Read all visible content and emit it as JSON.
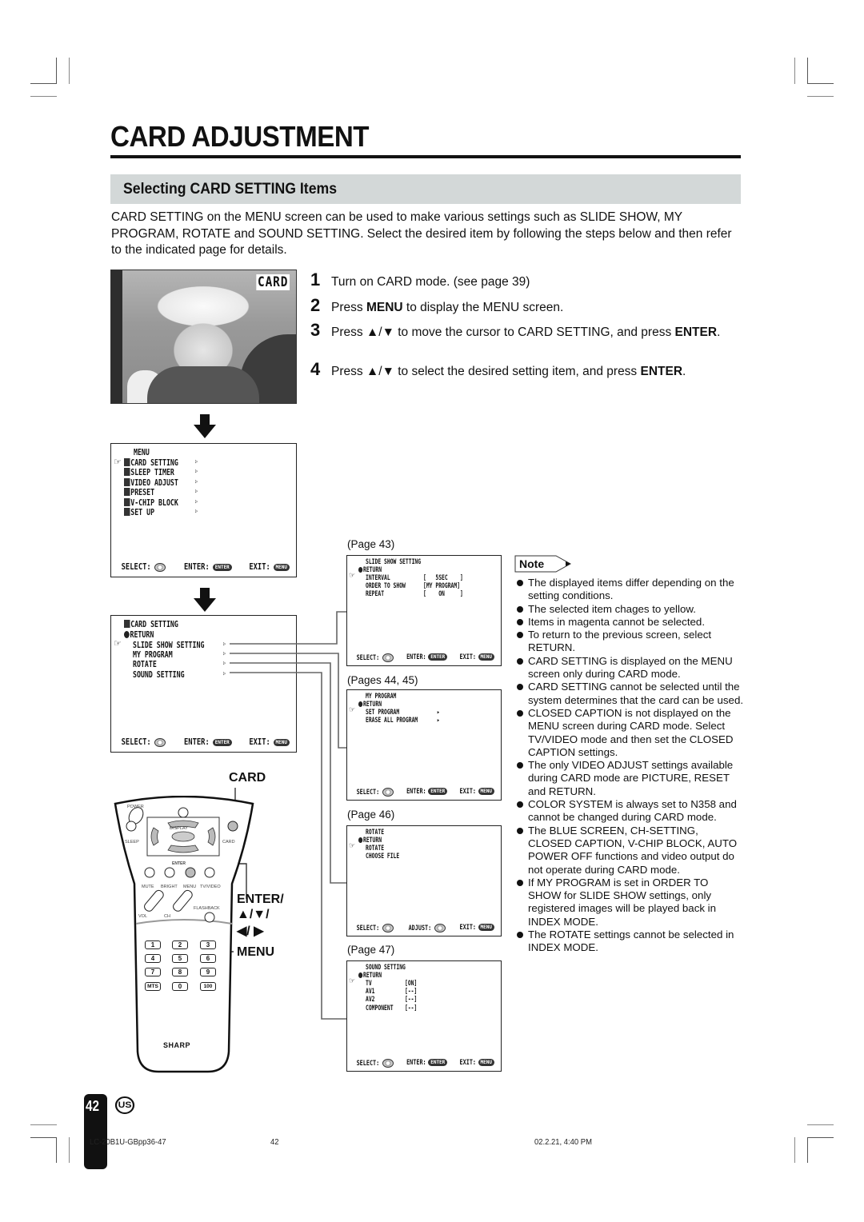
{
  "header": {
    "title": "CARD ADJUSTMENT",
    "section_title": "Selecting CARD SETTING Items",
    "intro": "CARD SETTING on the MENU screen can be used to make various settings such as SLIDE SHOW, MY PROGRAM, ROTATE and SOUND SETTING. Select the desired item by following the steps below and then refer to the indicated page for details."
  },
  "steps": [
    {
      "num": "1",
      "parts": [
        {
          "t": "Turn on CARD mode. (see page 39)",
          "b": false
        }
      ]
    },
    {
      "num": "2",
      "parts": [
        {
          "t": "Press ",
          "b": false
        },
        {
          "t": "MENU",
          "b": true
        },
        {
          "t": " to display the MENU screen.",
          "b": false
        }
      ]
    },
    {
      "num": "3",
      "parts": [
        {
          "t": "Press ▲/▼ to move the cursor to CARD SETTING, and press ",
          "b": false
        },
        {
          "t": "ENTER",
          "b": true
        },
        {
          "t": ".",
          "b": false
        }
      ]
    },
    {
      "num": "4",
      "parts": [
        {
          "t": "Press ▲/▼ to select the desired setting item, and press ",
          "b": false
        },
        {
          "t": "ENTER",
          "b": true
        },
        {
          "t": ".",
          "b": false
        }
      ]
    }
  ],
  "photo": {
    "overlay_label": "CARD"
  },
  "osd_footer": {
    "select": "SELECT:",
    "enter": "ENTER:",
    "exit": "EXIT:",
    "adjust": "ADJUST:",
    "enter_key": "ENTER",
    "menu_key": "MENU"
  },
  "menu_screen": {
    "title": "MENU",
    "items": [
      {
        "label": "CARD SETTING",
        "icon": "card-icon",
        "selected": true
      },
      {
        "label": "SLEEP TIMER",
        "icon": "clock-icon",
        "selected": false
      },
      {
        "label": "VIDEO ADJUST",
        "icon": "monitor-icon",
        "selected": false
      },
      {
        "label": "PRESET",
        "icon": "checkbox-icon",
        "selected": false
      },
      {
        "label": "V-CHIP BLOCK",
        "icon": "lock-icon",
        "selected": false
      },
      {
        "label": "SET UP",
        "icon": "list-icon",
        "selected": false
      }
    ]
  },
  "card_setting_screen": {
    "title": "CARD SETTING",
    "return_label": "RETURN",
    "items": [
      "SLIDE SHOW SETTING",
      "MY PROGRAM",
      "ROTATE",
      "SOUND SETTING"
    ]
  },
  "sub_screens": [
    {
      "page_ref": "(Page 43)",
      "title": "SLIDE SHOW SETTING",
      "return_label": "RETURN",
      "rows": [
        {
          "label": "INTERVAL",
          "value": "[   5SEC    ]"
        },
        {
          "label": "ORDER TO SHOW",
          "value": "[MY PROGRAM]"
        },
        {
          "label": "REPEAT",
          "value": "[    ON     ]"
        }
      ],
      "footer_mode": "enter"
    },
    {
      "page_ref": "(Pages 44, 45)",
      "title": "MY PROGRAM",
      "return_label": "RETURN",
      "rows": [
        {
          "label": "SET PROGRAM",
          "value": "▸"
        },
        {
          "label": "ERASE ALL PROGRAM",
          "value": "▸"
        }
      ],
      "footer_mode": "enter"
    },
    {
      "page_ref": "(Page 46)",
      "title": "ROTATE",
      "return_label": "RETURN",
      "rows": [
        {
          "label": "ROTATE",
          "value": ""
        },
        {
          "label": "CHOOSE FILE",
          "value": ""
        }
      ],
      "footer_mode": "adjust"
    },
    {
      "page_ref": "(Page 47)",
      "title": "SOUND SETTING",
      "return_label": "RETURN",
      "rows": [
        {
          "label": "TV",
          "value": "[ON]"
        },
        {
          "label": "AV1",
          "value": "[--]"
        },
        {
          "label": "AV2",
          "value": "[--]"
        },
        {
          "label": "COMPONENT",
          "value": "[--]"
        }
      ],
      "footer_mode": "enter"
    }
  ],
  "remote": {
    "callouts": {
      "card": "CARD",
      "enter": "ENTER/",
      "arrows_ud": "▲/▼/",
      "arrows_lr": "◀/ ▶",
      "menu": "MENU"
    },
    "labels": {
      "power": "POWER",
      "display": "DISPLAY",
      "sleep": "SLEEP",
      "card": "CARD",
      "enter": "ENTER",
      "mute": "MUTE",
      "bright": "BRIGHT",
      "menu": "MENU",
      "tvvideo": "TV/VIDEO",
      "flashback": "FLASHBACK",
      "vol": "VOL",
      "ch": "CH",
      "brand": "SHARP"
    },
    "keys": [
      "1",
      "2",
      "3",
      "4",
      "5",
      "6",
      "7",
      "8",
      "9",
      "MTS",
      "0",
      "100"
    ]
  },
  "note": {
    "label": "Note",
    "items": [
      "The displayed items differ depending on the setting conditions.",
      "The selected item chages to yellow.",
      "Items in magenta cannot be selected.",
      "To return to the previous screen, select RETURN.",
      "CARD SETTING is displayed on the MENU screen only during CARD mode.",
      "CARD SETTING cannot be selected until the system determines that the card can be used.",
      "CLOSED CAPTION is not displayed on the MENU screen during CARD mode. Select TV/VIDEO mode and then set the CLOSED CAPTION settings.",
      "The only VIDEO ADJUST settings available during CARD mode are PICTURE, RESET and RETURN.",
      "COLOR SYSTEM is always set to N358 and cannot be changed during CARD mode.",
      "The BLUE SCREEN, CH-SETTING, CLOSED CAPTION, V-CHIP BLOCK, AUTO POWER OFF functions and video output do not operate during CARD mode.",
      "If MY PROGRAM is set in ORDER TO SHOW for SLIDE SHOW settings, only registered images will be played back in INDEX MODE.",
      "The ROTATE settings cannot be selected in INDEX MODE."
    ]
  },
  "footer": {
    "page_number": "42",
    "region_badge": "US",
    "file_name": "LC-20B1U-GBpp36-47",
    "print_page": "42",
    "print_date": "02.2.21, 4:40 PM"
  }
}
